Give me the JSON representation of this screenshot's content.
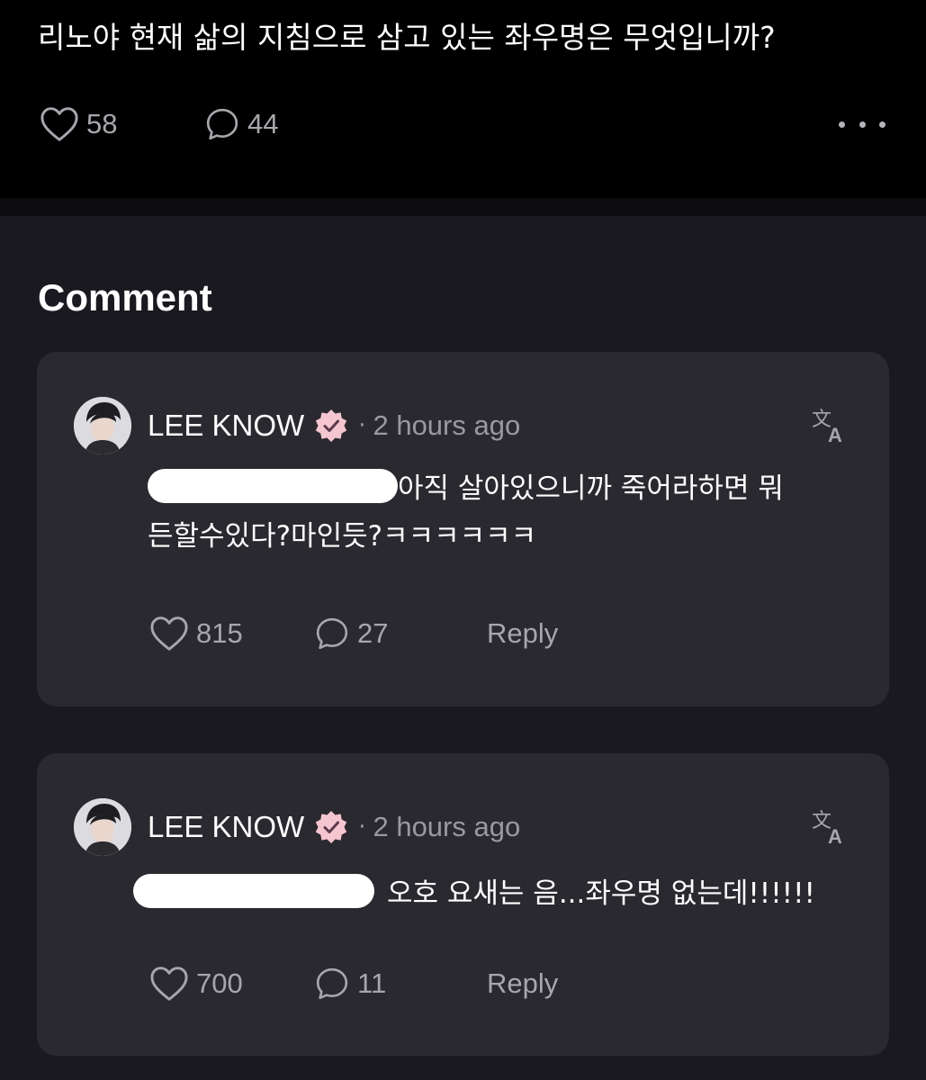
{
  "post": {
    "title": "리노야 현재 삶의 지침으로 삼고 있는 좌우명은 무엇입니까?",
    "likes": "58",
    "comments": "44"
  },
  "comments_section": {
    "title": "Comment",
    "comments": [
      {
        "author": "LEE KNOW",
        "time": "2 hours ago",
        "line1": "아직 살아있으니까 죽어라하면 뭐",
        "line2": "든할수있다?마인듯?ㅋㅋㅋㅋㅋㅋ",
        "likes": "815",
        "replies": "27",
        "reply_label": "Reply"
      },
      {
        "author": "LEE KNOW",
        "time": "2 hours ago",
        "line1": "오호 요새는 음...좌우명 없는데!!!!!!",
        "likes": "700",
        "replies": "11",
        "reply_label": "Reply"
      }
    ]
  },
  "icons": {
    "like": "heart-icon",
    "comment": "speech-bubble-icon",
    "more": "more-dots-icon",
    "verified": "verified-badge-icon",
    "translate": "translate-icon"
  },
  "colors": {
    "background": "#1a1920",
    "post_background": "#000000",
    "card": "#2a292f",
    "muted_text": "#a7a6ac",
    "verified_badge": "#f6c6d0"
  }
}
